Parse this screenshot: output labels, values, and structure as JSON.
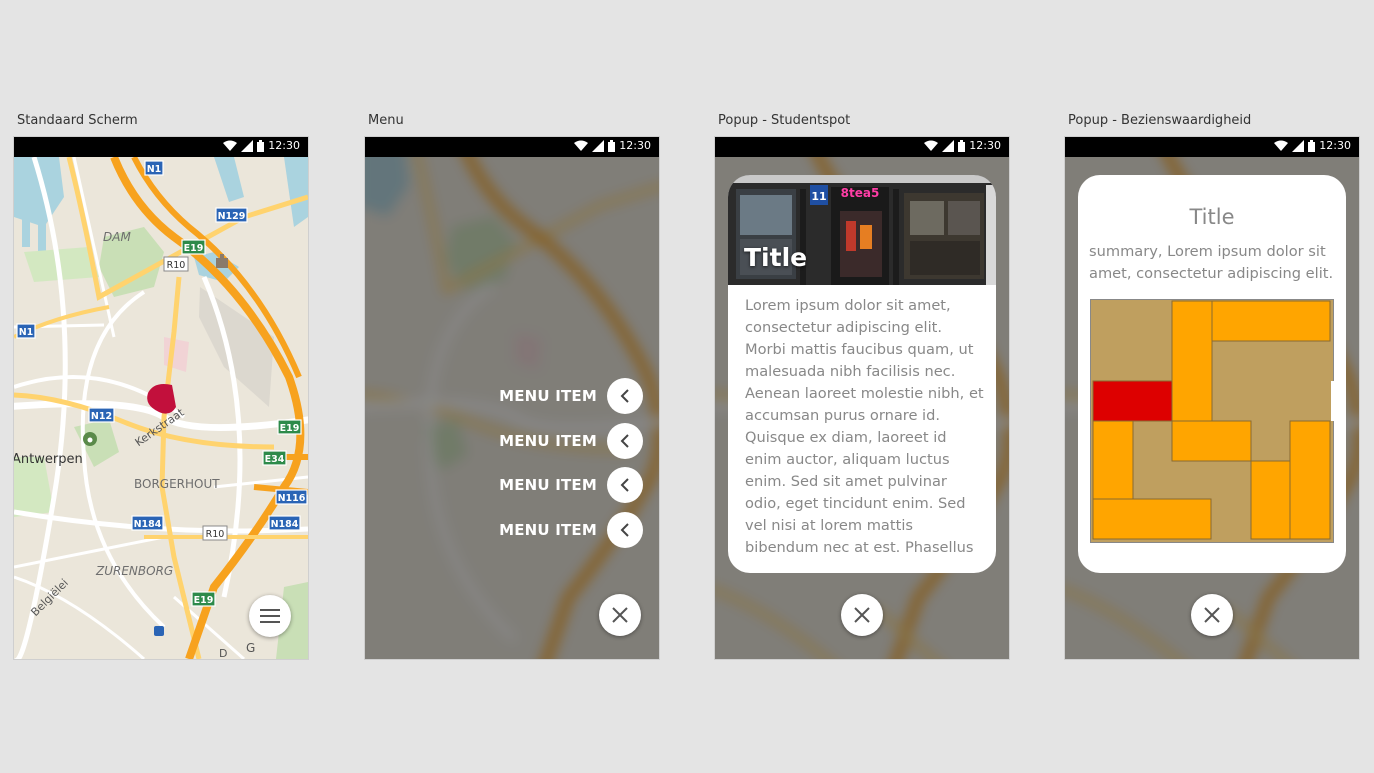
{
  "screens": [
    {
      "label": "Standaard Scherm"
    },
    {
      "label": "Menu"
    },
    {
      "label": "Popup - Studentspot"
    },
    {
      "label": "Popup - Bezienswaardigheid"
    }
  ],
  "status_bar": {
    "time": "12:30"
  },
  "map": {
    "labels": {
      "dam": "DAM",
      "antwerpen": "Antwerpen",
      "borgerhout": "BORGERHOUT",
      "zurenborg": "ZURENBORG",
      "belgielei": "Belgiëlei",
      "street": "Kerkstraat",
      "corner_g": "G",
      "corner_d": "D"
    },
    "shields": {
      "n1_top": "N1",
      "n129": "N129",
      "e19_top": "E19",
      "r10_top": "R10",
      "n1_left": "N1",
      "n12": "N12",
      "e19_mid": "E19",
      "e34": "E34",
      "n116": "N116",
      "n184_left": "N184",
      "r10_bottom": "R10",
      "n184_right": "N184",
      "e19_bottom": "E19"
    }
  },
  "menu": {
    "items": [
      {
        "label": "MENU ITEM"
      },
      {
        "label": "MENU ITEM"
      },
      {
        "label": "MENU ITEM"
      },
      {
        "label": "MENU ITEM"
      }
    ]
  },
  "studentspot": {
    "title": "Title",
    "shop_sign": "8tea5",
    "house_number": "11",
    "body": "Lorem ipsum dolor sit amet, consectetur adipiscing elit. Morbi mattis faucibus quam, ut malesuada nibh facilisis nec. Aenean laoreet molestie nibh, et accumsan purus ornare id. Quisque ex diam, laoreet id enim auctor, aliquam luctus enim. Sed sit amet pulvinar odio, eget tincidunt enim. Sed vel nisi at lorem mattis bibendum nec at est. Phasellus"
  },
  "bezienswaardigheid": {
    "title": "Title",
    "summary": "summary, Lorem ipsum dolor sit amet, consectetur adipiscing elit."
  },
  "colors": {
    "background": "#e4e4e4",
    "puzzle_board": "#bf9f5f",
    "puzzle_orange": "#ffa500",
    "puzzle_red": "#dd0000",
    "map_pin": "#c2103c",
    "highway": "#f7a21e"
  }
}
